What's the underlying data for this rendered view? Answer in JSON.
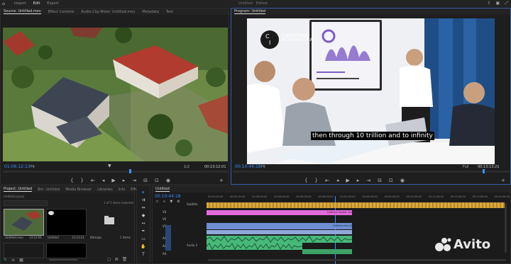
{
  "menu": {
    "items": [
      "Import",
      "Edit",
      "Export"
    ],
    "active": "Edit",
    "project": "Untitled",
    "status": "Edited"
  },
  "source_panel": {
    "tabs": [
      "Source: Untitled.mov",
      "Effect Controls",
      "Audio Clip Mixer: Untitled.mov",
      "Metadata",
      "Text"
    ],
    "timecode": "01:06:12:13",
    "fit": "Fit",
    "fraction": "1/2",
    "duration": "00:13:12:01"
  },
  "program_panel": {
    "title": "Program: Untitled",
    "timecode": "00:10:44:18",
    "fit": "Fit",
    "quality": "Full",
    "duration": "00:13:13:21",
    "logo_line1": "CONSULTING",
    "logo_line2": "INTERNATIONAL",
    "subtitle": "then through 10 trillion and to infinity"
  },
  "project_panel": {
    "tabs": [
      "Project: Untitled",
      "Bin: Untitled",
      "Media Browser",
      "Libraries",
      "Info",
      "Effects"
    ],
    "file": "Untitled.prproj",
    "selection": "1 of 5 items selected",
    "items": [
      {
        "name": "Untitled.mov",
        "duration": "13:12:01"
      },
      {
        "name": "Untitled",
        "duration": "13:13:21"
      },
      {
        "name": "Untitled",
        "duration": "13:12:01"
      },
      {
        "name": "Untitled",
        "duration": "13:13:21"
      },
      {
        "name": "Bitmaps",
        "duration": "1 items"
      }
    ]
  },
  "timeline": {
    "tab": "Untitled",
    "timecode": "00:10:44:18",
    "ruler": [
      "00:01:00:00",
      "00:02:00:00",
      "00:03:00:00",
      "00:04:00:00",
      "00:05:00:00",
      "00:06:00:00",
      "00:07:00:00",
      "00:08:00:00",
      "00:09:00:00",
      "00:10:00:00",
      "00:11:00:00",
      "00:12:00:00",
      "00:13:00:00",
      "00:14:00:00"
    ],
    "tracks": [
      "V3",
      "V2",
      "V1",
      "A1",
      "A2",
      "A3"
    ],
    "subtitles_label": "Subtitle",
    "graphic_clip": "Untitled Caption Graphic",
    "video_clip": "Untitled.mov [V]",
    "audio_label": "Audio 2"
  },
  "watermark": "Avito"
}
